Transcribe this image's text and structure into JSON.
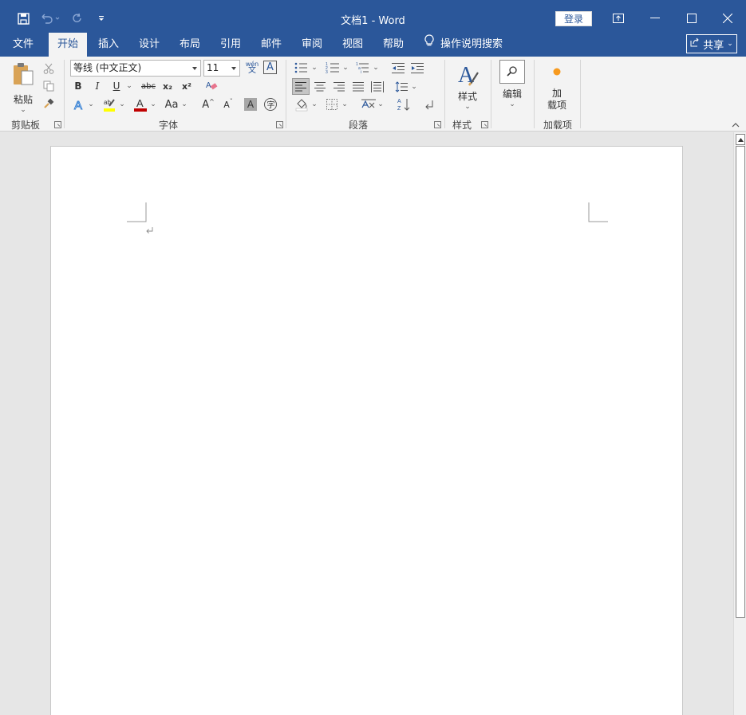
{
  "app": {
    "title": "文档1  -  Word",
    "login_label": "登录"
  },
  "tabs": [
    {
      "label": "文件"
    },
    {
      "label": "开始"
    },
    {
      "label": "插入"
    },
    {
      "label": "设计"
    },
    {
      "label": "布局"
    },
    {
      "label": "引用"
    },
    {
      "label": "邮件"
    },
    {
      "label": "审阅"
    },
    {
      "label": "视图"
    },
    {
      "label": "帮助"
    }
  ],
  "tell_me": {
    "label": "操作说明搜索"
  },
  "share": {
    "label": "共享"
  },
  "ribbon": {
    "clipboard": {
      "label": "剪贴板",
      "paste_label": "粘贴"
    },
    "font": {
      "label": "字体",
      "font_name": "等线 (中文正文)",
      "font_size": "11",
      "bold": "B",
      "italic": "I",
      "underline": "U",
      "strike": "abc",
      "sub": "x₂",
      "sup": "x²",
      "change_case": "Aa",
      "grow": "A",
      "shrink": "A",
      "pinyin_top": "wén",
      "pinyin_bottom": "文"
    },
    "paragraph": {
      "label": "段落"
    },
    "styles": {
      "label": "样式",
      "btn_label": "样式"
    },
    "editing": {
      "label": "编辑"
    },
    "addins": {
      "label": "加载项",
      "btn_line1": "加",
      "btn_line2": "载项"
    }
  },
  "colors": {
    "brand": "#2b579a",
    "font_color": "#c00000",
    "highlight": "#ffff00",
    "addin_dot": "#f79a1e"
  }
}
